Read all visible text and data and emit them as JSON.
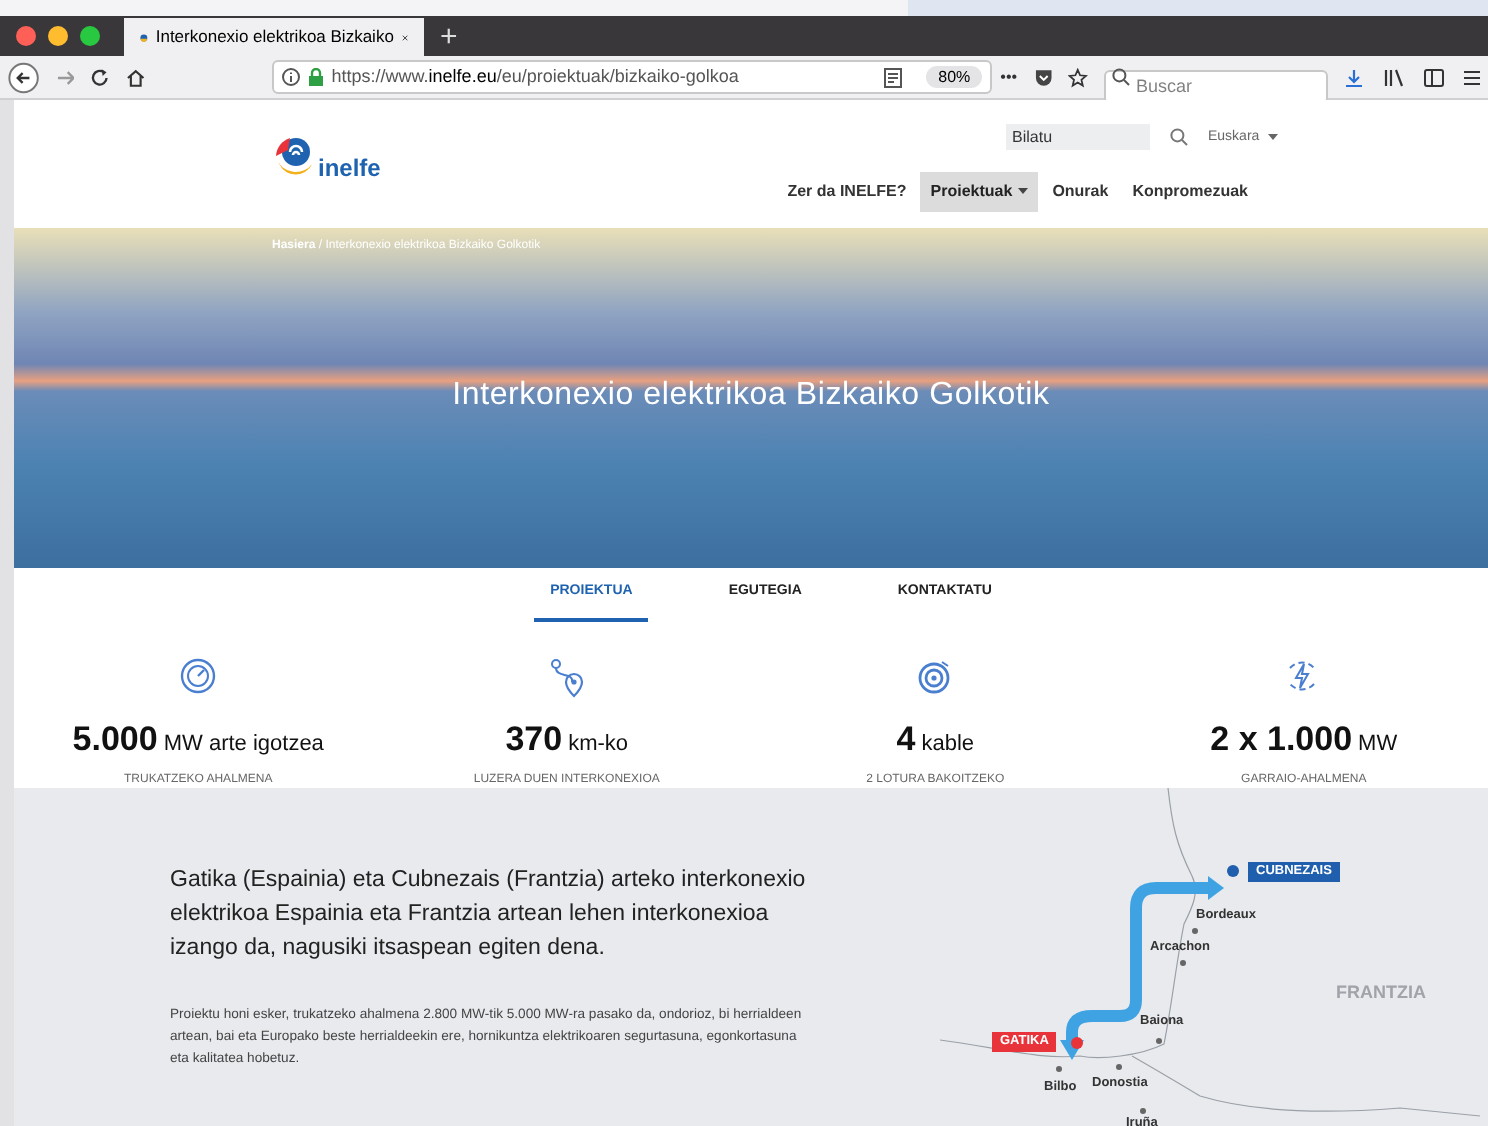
{
  "browser": {
    "tab_title": "Interkonexio elektrikoa Bizkaiko",
    "new_tab": "+",
    "url_prefix": "https://www.",
    "url_domain": "inelfe.eu",
    "url_path": "/eu/proiektuak/bizkaiko-golkoa",
    "zoom": "80%",
    "more": "•••",
    "search_placeholder": "Buscar"
  },
  "header": {
    "logo_text": "inelfe",
    "search_placeholder": "Bilatu",
    "language": "Euskara",
    "nav": [
      {
        "label": "Zer da INELFE?",
        "selected": false,
        "dropdown": false
      },
      {
        "label": "Proiektuak",
        "selected": true,
        "dropdown": true
      },
      {
        "label": "Onurak",
        "selected": false,
        "dropdown": false
      },
      {
        "label": "Konpromezuak",
        "selected": false,
        "dropdown": false
      }
    ]
  },
  "hero": {
    "breadcrumb_home": "Hasiera",
    "breadcrumb_rest": " / Interkonexio elektrikoa Bizkaiko Golkotik",
    "title": "Interkonexio elektrikoa Bizkaiko Golkotik"
  },
  "section_tabs": [
    {
      "label": "PROIEKTUA",
      "selected": true
    },
    {
      "label": "EGUTEGIA",
      "selected": false
    },
    {
      "label": "KONTAKTATU",
      "selected": false
    }
  ],
  "stats": [
    {
      "kind": "gauge",
      "value": "5.000",
      "unit": "MW arte igotzea",
      "caption": "TRUKATZEKO AHALMENA"
    },
    {
      "kind": "route",
      "value": "370",
      "unit": "km-ko",
      "caption": "LUZERA DUEN INTERKONEXIOA"
    },
    {
      "kind": "cable",
      "value": "4",
      "unit": "kable",
      "caption": "2 LOTURA BAKOITZEKO"
    },
    {
      "kind": "power",
      "value": "2 x 1.000",
      "unit": "MW",
      "caption": "GARRAIO-AHALMENA"
    }
  ],
  "intro": {
    "lead": "Gatika (Espainia) eta Cubnezais (Frantzia) arteko interkonexio elektrikoa Espainia eta Frantzia artean lehen interkonexioa izango da, nagusiki itsaspean egiten dena.",
    "body": "Proiektu honi esker, trukatzeko ahalmena 2.800 MW-tik 5.000 MW-ra pasako da, ondorioz, bi herrialdeen artean, bai eta Europako beste herrialdeekin ere, hornikuntza elektrikoaren segurtasuna, egonkortasuna eta kalitatea hobetuz."
  },
  "map": {
    "country": "FRANTZIA",
    "endpoints": [
      {
        "label": "CUBNEZAIS",
        "color": "#1f5fae"
      },
      {
        "label": "GATIKA",
        "color": "#e8333a"
      }
    ],
    "cities": [
      "Bordeaux",
      "Arcachon",
      "Baiona",
      "Bilbo",
      "Donostia",
      "Iruña"
    ]
  }
}
